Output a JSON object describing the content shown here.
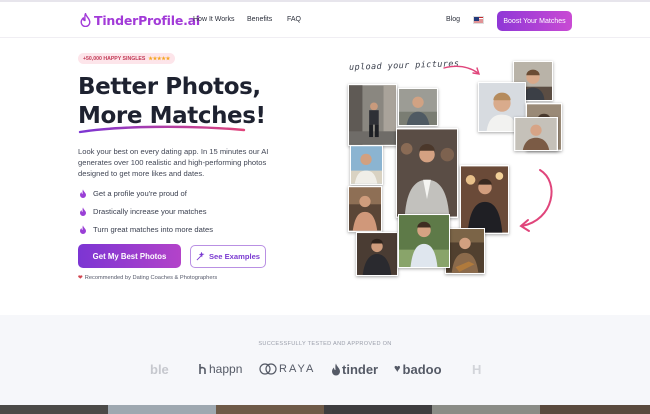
{
  "header": {
    "logo_text": "TinderProfile.ai",
    "nav": [
      "How It Works",
      "Benefits",
      "FAQ"
    ],
    "blog": "Blog",
    "flag_icon": "us-flag-icon",
    "cta": "Boost Your Matches"
  },
  "hero": {
    "badge": "+50,000 HAPPY SINGLES",
    "badge_stars": "★★★★★",
    "title_line1": "Better Photos,",
    "title_line2": "More Matches!",
    "description": [
      "Look your best on every dating app. In 15 minutes our AI",
      "generates over 100 realistic and high-performing photos",
      "designed to get more likes and dates."
    ],
    "benefits": [
      "Get a profile you're proud of",
      "Drastically increase your matches",
      "Turn great matches into more dates"
    ],
    "primary_button": "Get My Best Photos",
    "secondary_button": "See Examples",
    "recommended": "Recommended by Dating Coaches & Photographers",
    "upload_caption": "upload your pictures"
  },
  "apps": {
    "tested_label": "SUCCESSFULLY TESTED AND APPROVED ON",
    "logos": [
      "ble",
      "happn",
      "RAYA",
      "tinder",
      "badoo",
      "H"
    ]
  },
  "colors": {
    "brand": "#a23ad8",
    "cta_gradient_start": "#7c35d3",
    "cta_gradient_end": "#b343c9",
    "accent_pink": "#e0457b"
  }
}
